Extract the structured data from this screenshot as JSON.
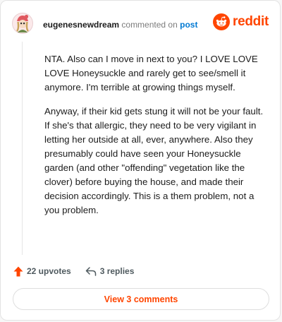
{
  "comment": {
    "username": "eugenesnewdream",
    "action_text": "commented on",
    "post_link": "post",
    "paragraphs": [
      "NTA. Also can I move in next to you? I LOVE LOVE LOVE Honeysuckle and rarely get to see/smell it anymore. I'm terrible at growing things myself.",
      "Anyway, if their kid gets stung it will not be your fault. If she's that allergic, they need to be very vigilant in letting her outside at all, ever, anywhere. Also they presumably could have seen your Honeysuckle garden (and other \"offending\" vegetation like the clover) before buying the house, and made their decision accordingly. This is a them problem, not a you problem."
    ]
  },
  "brand": {
    "wordmark": "reddit",
    "color": "#ff4500"
  },
  "actions": {
    "upvotes": "22 upvotes",
    "replies": "3 replies"
  },
  "footer": {
    "view_comments_label": "View 3 comments"
  },
  "icons": {
    "avatar": "user-avatar",
    "logo": "reddit-snoo-icon",
    "upvote": "upvote-arrow-icon",
    "reply": "reply-arrow-icon"
  }
}
